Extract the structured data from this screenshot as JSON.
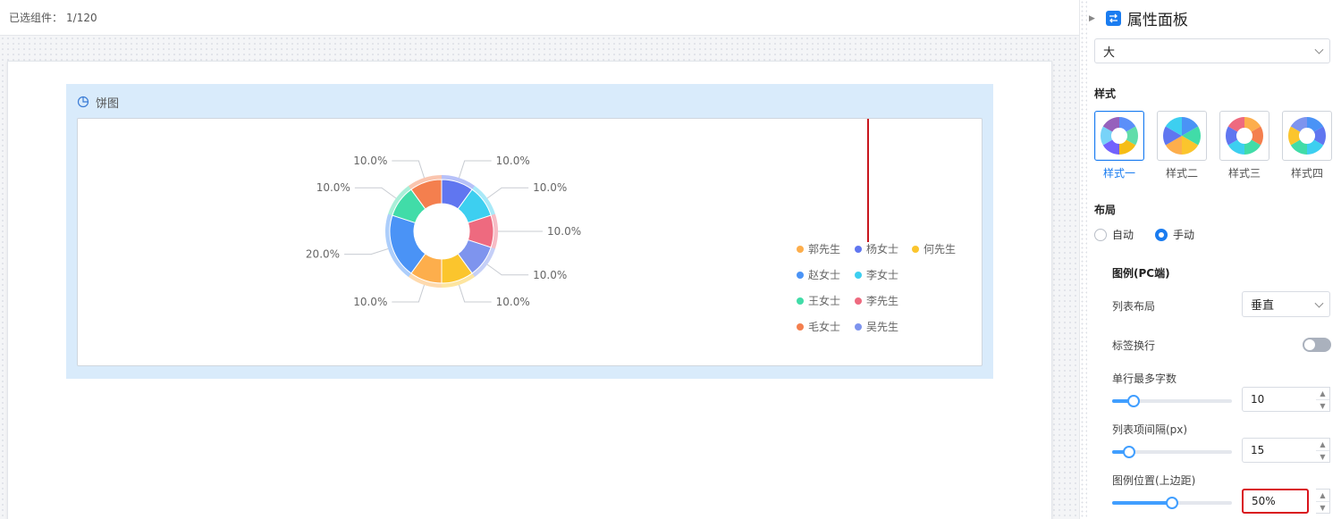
{
  "topbar": {
    "selected_label": "已选组件：",
    "selected_count": "1/120"
  },
  "widget": {
    "title": "饼图",
    "title_icon": "pie-chart-icon"
  },
  "chart_data": {
    "type": "pie",
    "donut": true,
    "slices": [
      {
        "name": "杨女士",
        "value": 10.0,
        "label": "10.0%",
        "color": "#6076f0"
      },
      {
        "name": "李女士",
        "value": 10.0,
        "label": "10.0%",
        "color": "#3dcff0"
      },
      {
        "name": "李先生",
        "value": 10.0,
        "label": "10.0%",
        "color": "#ee6a7f"
      },
      {
        "name": "吴先生",
        "value": 10.0,
        "label": "10.0%",
        "color": "#7e94ee"
      },
      {
        "name": "何先生",
        "value": 10.0,
        "label": "10.0%",
        "color": "#fbc52d"
      },
      {
        "name": "郭先生",
        "value": 10.0,
        "label": "10.0%",
        "color": "#fdae4c"
      },
      {
        "name": "赵女士",
        "value": 20.0,
        "label": "20.0%",
        "color": "#4a93f6"
      },
      {
        "name": "王女士",
        "value": 10.0,
        "label": "10.0%",
        "color": "#41dca8"
      },
      {
        "name": "毛女士",
        "value": 10.0,
        "label": "10.0%",
        "color": "#f47f4e"
      }
    ],
    "legend": {
      "position": "right-middle",
      "rows": [
        [
          "郭先生",
          "杨女士",
          "何先生"
        ],
        [
          "赵女士",
          "李女士"
        ],
        [
          "王女士",
          "李先生"
        ],
        [
          "毛女士",
          "吴先生"
        ]
      ]
    }
  },
  "panel": {
    "title": "属性面板",
    "title_icon": "property-panel-icon",
    "size_select": "大",
    "style_section": "样式",
    "styles": [
      {
        "label": "样式一",
        "active": true
      },
      {
        "label": "样式二",
        "active": false
      },
      {
        "label": "样式三",
        "active": false
      },
      {
        "label": "样式四",
        "active": false
      }
    ],
    "layout_section": "布局",
    "layout_auto": "自动",
    "layout_manual": "手动",
    "legend_section": "图例(PC端)",
    "list_layout_label": "列表布局",
    "list_layout_value": "垂直",
    "wrap_label": "标签换行",
    "wrap_on": false,
    "max_chars_label": "单行最多字数",
    "max_chars_value": "10",
    "max_chars_fraction": 0.18,
    "item_gap_label": "列表项间隔(px)",
    "item_gap_value": "15",
    "item_gap_fraction": 0.14,
    "legend_top_label": "图例位置(上边距)",
    "legend_top_value": "50%",
    "legend_top_fraction": 0.5
  }
}
